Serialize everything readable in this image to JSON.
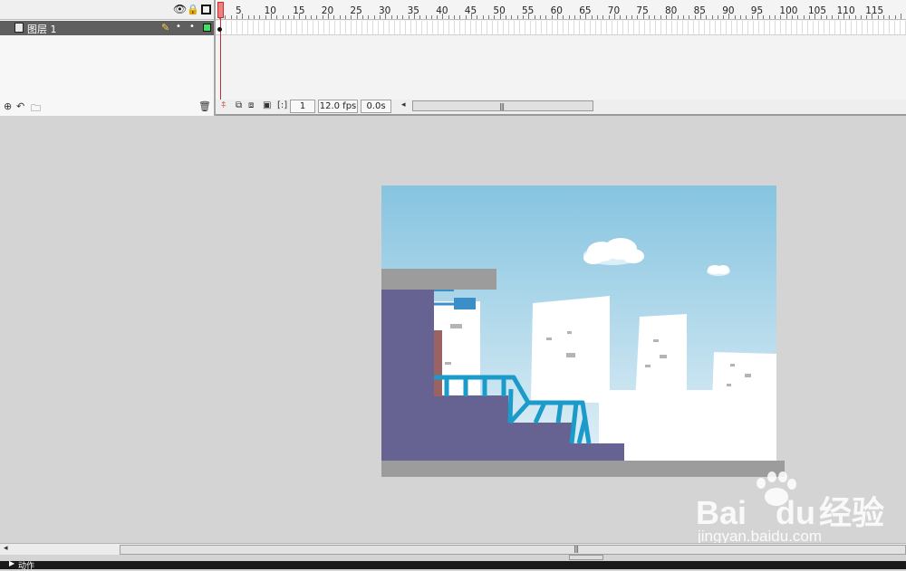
{
  "timeline": {
    "layer_name": "图层 1",
    "ruler_labels": [
      "5",
      "10",
      "15",
      "20",
      "25",
      "30",
      "35",
      "40",
      "45",
      "50",
      "55",
      "60",
      "65",
      "70",
      "75",
      "80",
      "85",
      "90",
      "95",
      "100",
      "105",
      "110",
      "115"
    ],
    "current_frame": "1",
    "fps": "12.0 fps",
    "elapsed_time": "0.0s",
    "layer_color": "#40e060"
  },
  "bottom_panel": {
    "actions_label": "动作"
  },
  "watermark": {
    "brand": "Bai",
    "brand_tail": "du",
    "brand_cn": "经验",
    "url": "jingyan.baidu.com"
  },
  "stage": {
    "sky_top": "#86c4e0",
    "sky_bottom": "#e6f2f8",
    "building_color": "#ffffff",
    "wall_color": "#666393",
    "railing_color": "#1a9bc9",
    "ledge_color": "#9c9c9c"
  }
}
